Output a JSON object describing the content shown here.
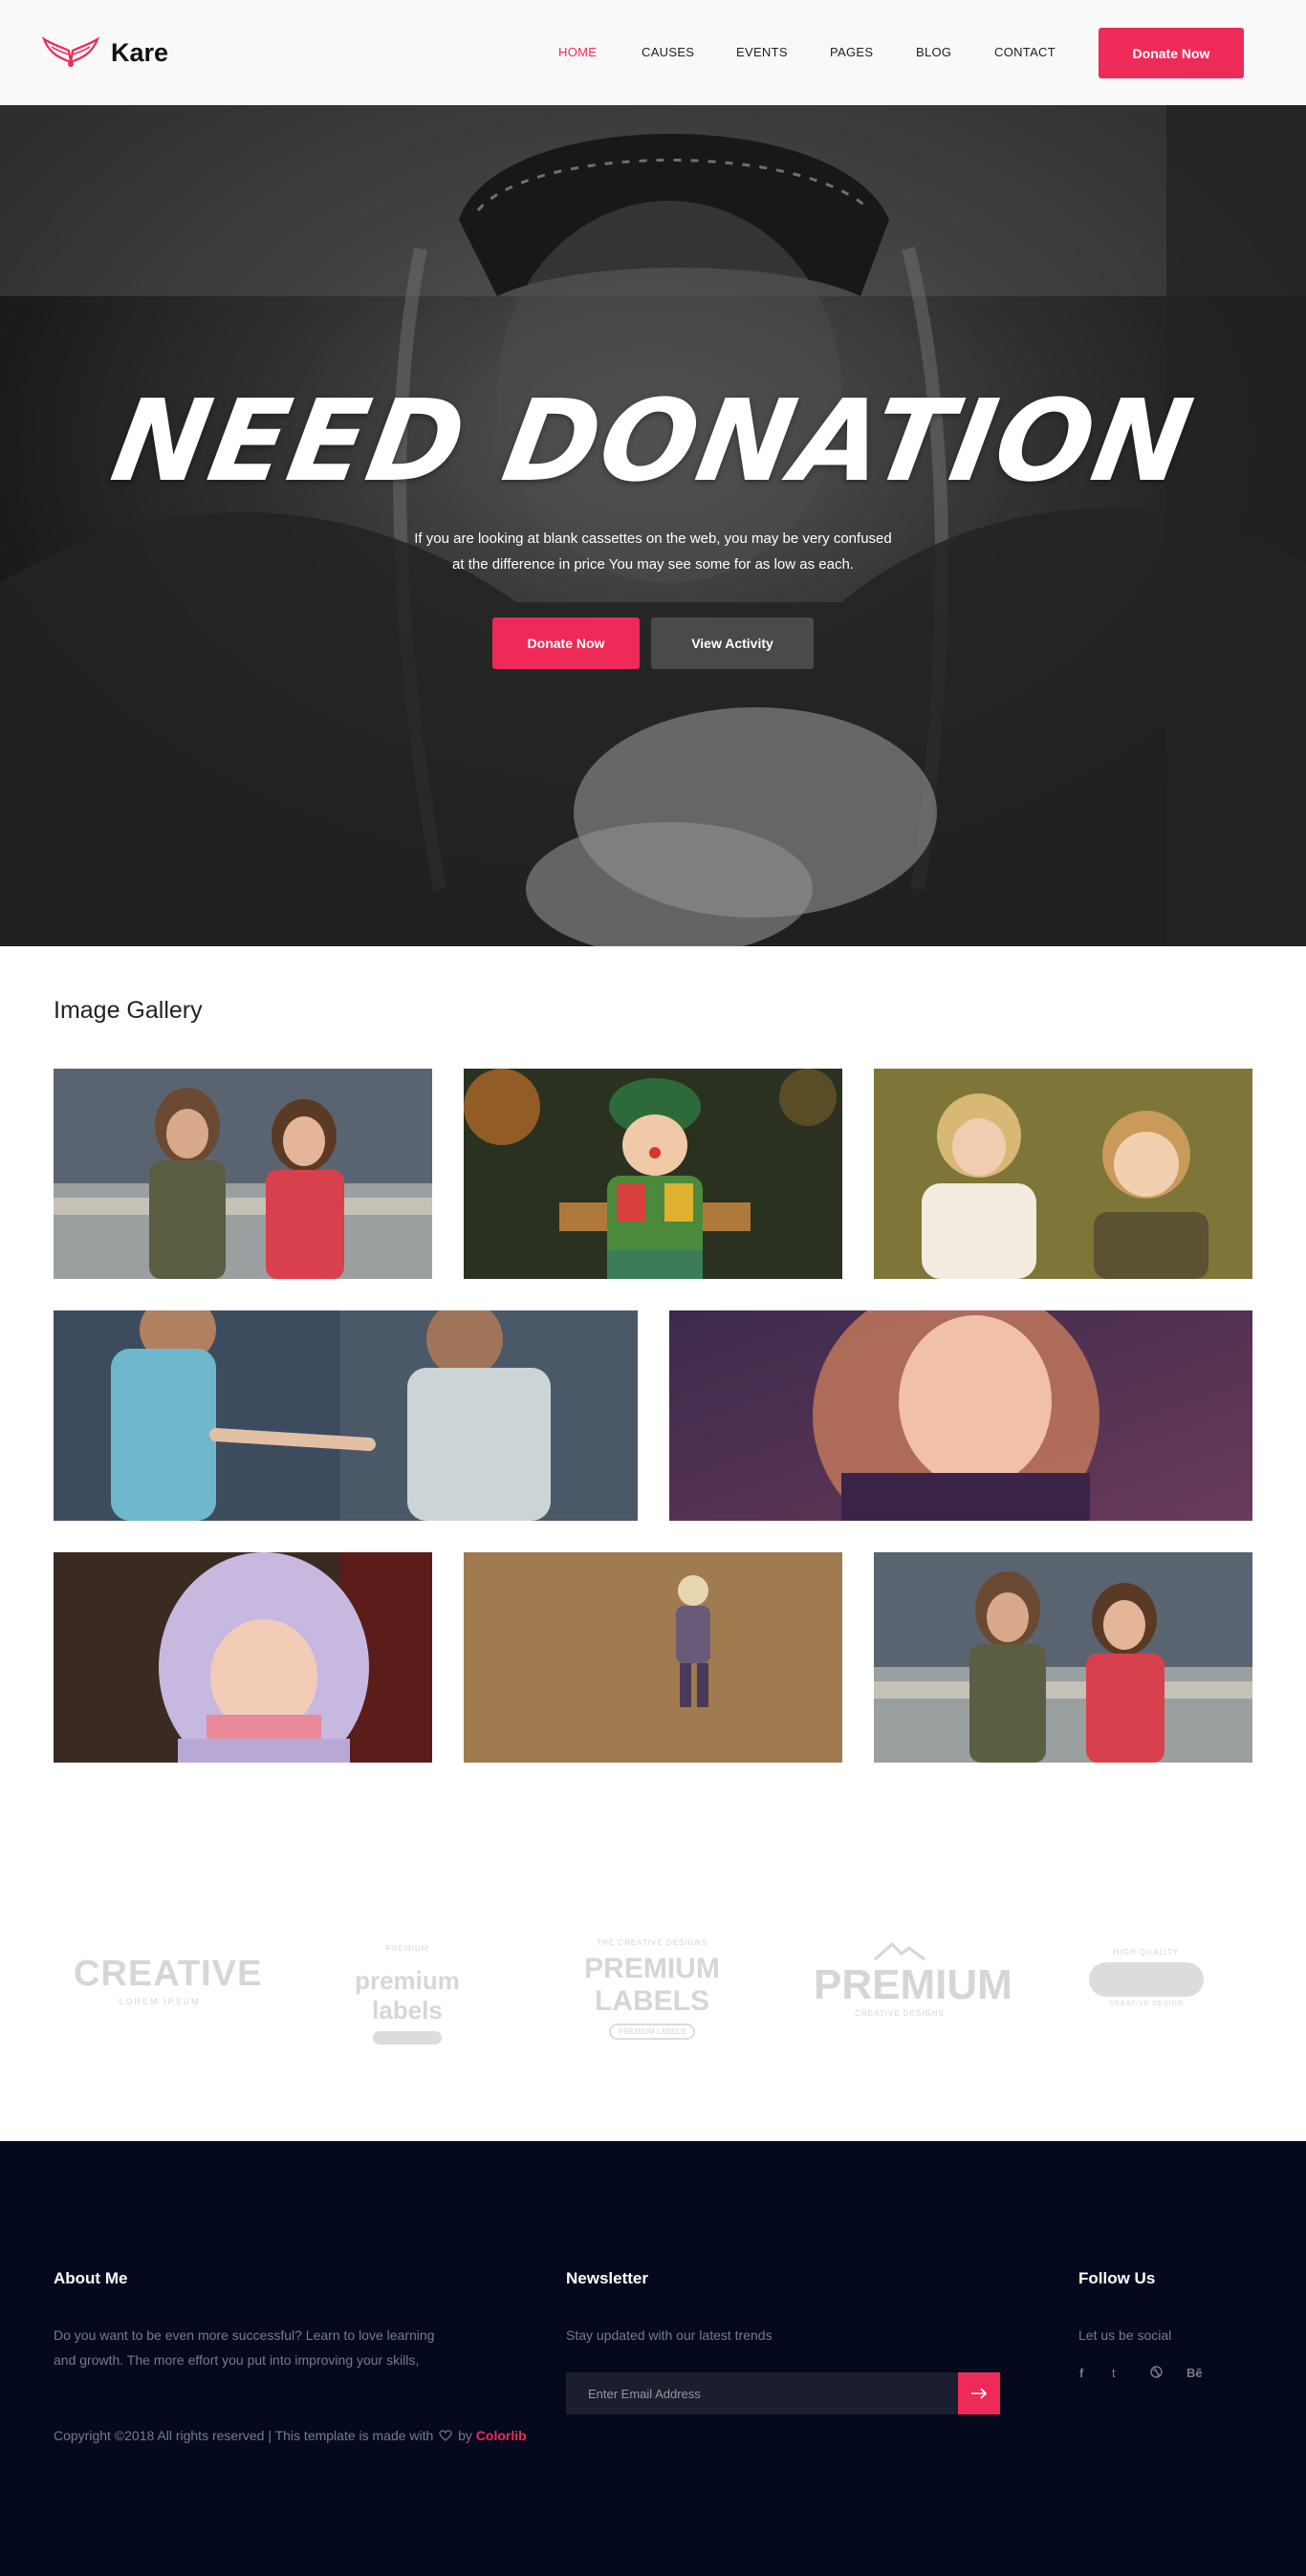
{
  "brand": {
    "name": "Kare"
  },
  "nav": {
    "items": [
      {
        "label": "HOME",
        "active": true
      },
      {
        "label": "CAUSES"
      },
      {
        "label": "EVENTS"
      },
      {
        "label": "PAGES"
      },
      {
        "label": "BLOG"
      },
      {
        "label": "CONTACT"
      }
    ],
    "cta": "Donate Now"
  },
  "hero": {
    "title": "NEED DONATION",
    "text_line1": "If you are looking at blank cassettes on the web, you may be very confused",
    "text_line2": "at the difference in price You may see some for as low as each.",
    "primary_button": "Donate Now",
    "secondary_button": "View Activity"
  },
  "gallery": {
    "title": "Image Gallery"
  },
  "brands": {
    "items": [
      {
        "main": "CREATIVE",
        "sub": "LOREM IPSUM"
      },
      {
        "main": "premium labels",
        "top": "PREMIUM"
      },
      {
        "main": "PREMIUM LABELS",
        "top": "THE CREATIVE DESIGNS",
        "sub": "PREMIUM LABELS"
      },
      {
        "main": "PREMIUM",
        "sub": "CREATIVE DESIGNS"
      },
      {
        "main": "",
        "top": "HIGH QUALITY",
        "sub": "CREATIVE DESIGN"
      }
    ]
  },
  "footer": {
    "about_title": "About Me",
    "about_line1": "Do you want to be even more successful? Learn to love learning",
    "about_line2": "and growth. The more effort you put into improving your skills,",
    "newsletter_title": "Newsletter",
    "newsletter_text": "Stay updated with our latest trends",
    "newsletter_placeholder": "Enter Email Address",
    "follow_title": "Follow Us",
    "follow_text": "Let us be social",
    "social": [
      "f",
      "t",
      "d",
      "Bē"
    ],
    "copyright_prefix": "Copyright ©2018 All rights reserved | This template is made with",
    "copyright_by": "by",
    "copyright_brand": "Colorlib"
  },
  "colors": {
    "accent": "#ee2a59",
    "footer_bg": "#04091e",
    "header_bg": "#f9f9f9"
  }
}
